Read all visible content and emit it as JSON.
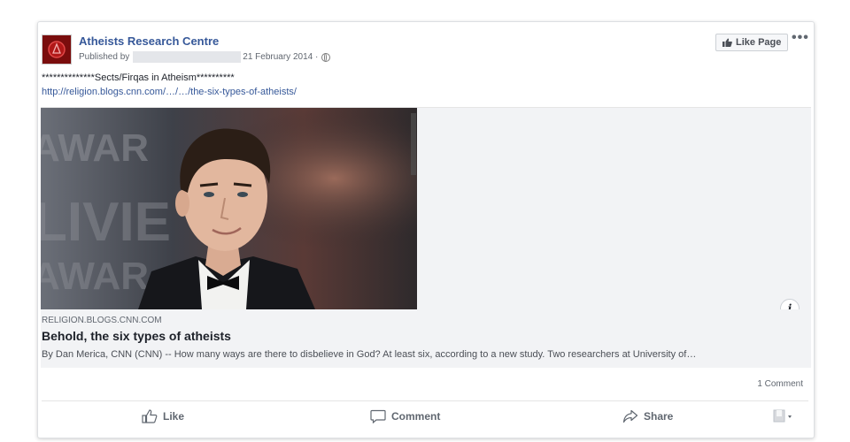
{
  "post": {
    "page_name": "Atheists Research Centre",
    "published_prefix": "Published by",
    "date": "21 February 2014 ·",
    "like_page_label": "Like Page",
    "more_label": "•••",
    "text": "**************Sects/Firqas in Atheism**********",
    "link_url": "http://religion.blogs.cnn.com/…/…/the-six-types-of-atheists/"
  },
  "link_preview": {
    "domain": "RELIGION.BLOGS.CNN.COM",
    "title": "Behold, the six types of atheists",
    "description": "By Dan Merica, CNN (CNN) -- How many ways are there to disbelieve in God? At least six, according to a new study. Two researchers at University of…",
    "info_label": "i"
  },
  "stats": {
    "comments": "1 Comment"
  },
  "actions": {
    "like": "Like",
    "comment": "Comment",
    "share": "Share"
  },
  "colors": {
    "link": "#365899",
    "muted": "#616770",
    "preview_bg": "#f2f3f5"
  },
  "icons": [
    "globe-icon",
    "thumbs-up-icon",
    "more-icon",
    "info-icon",
    "comment-icon",
    "share-icon",
    "reaction-selector-icon"
  ]
}
